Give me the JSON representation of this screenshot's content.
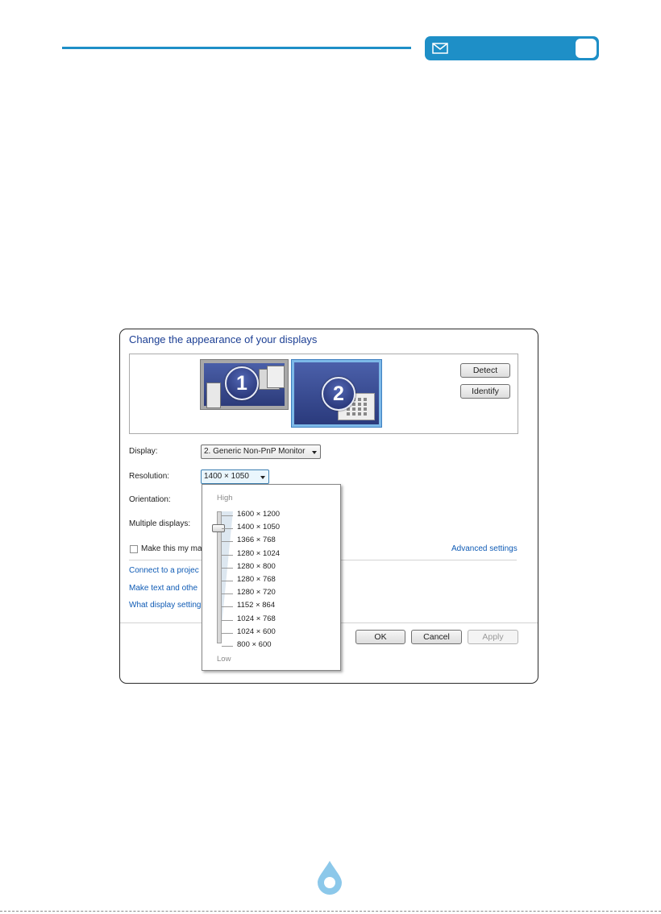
{
  "dialog": {
    "title": "Change the appearance of your displays",
    "monitors": [
      {
        "number": "1"
      },
      {
        "number": "2"
      }
    ],
    "buttons": {
      "detect": "Detect",
      "identify": "Identify",
      "ok": "OK",
      "cancel": "Cancel",
      "apply": "Apply"
    },
    "display": {
      "label": "Display:",
      "value": "2. Generic Non-PnP Monitor"
    },
    "resolution": {
      "label": "Resolution:",
      "value": "1400 × 1050"
    },
    "orientation": {
      "label": "Orientation:"
    },
    "multiple_displays": {
      "label": "Multiple displays:"
    },
    "main_display_checkbox": {
      "label": "Make this my ma",
      "checked": false
    },
    "advanced_settings": "Advanced settings",
    "links": [
      "Connect to a projec",
      "Make text and othe",
      "What display setting"
    ]
  },
  "resolution_dropdown": {
    "high_label": "High",
    "low_label": "Low",
    "options": [
      "1600 × 1200",
      "1400 × 1050",
      "1366 × 768",
      "1280 × 1024",
      "1280 × 800",
      "1280 × 768",
      "1280 × 720",
      "1152 × 864",
      "1024 × 768",
      "1024 × 600",
      "800 × 600"
    ],
    "selected_index": 1
  },
  "colors": {
    "accent": "#1e8fc7",
    "link": "#0f5bb5",
    "title": "#1c3f94"
  },
  "icons": {
    "header": "envelope-icon",
    "footer": "water-drop-icon"
  }
}
